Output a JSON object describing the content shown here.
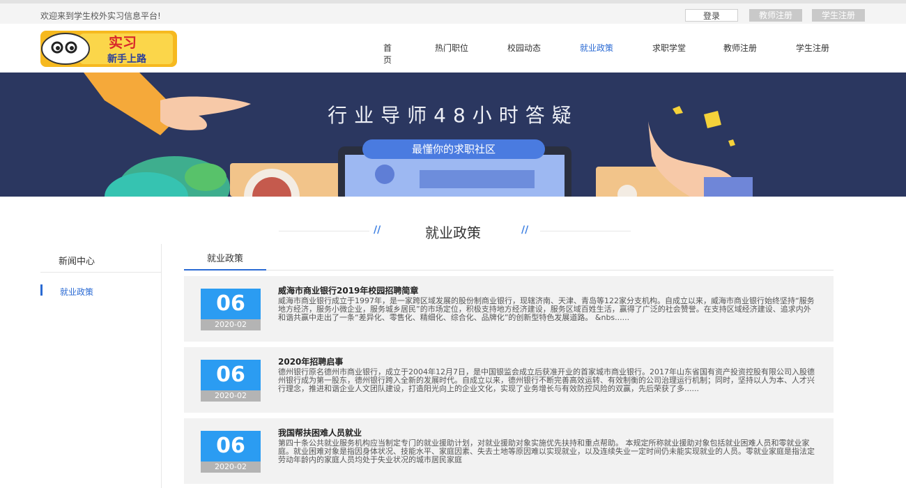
{
  "topbar": {
    "welcome": "欢迎来到学生校外实习信息平台!",
    "login": "登录",
    "teacher_register": "教师注册",
    "student_register": "学生注册"
  },
  "logo": {
    "text_top": "实习",
    "text_bottom": "新手上路"
  },
  "nav": {
    "items": [
      "首页",
      "热门职位",
      "校园动态",
      "就业政策",
      "求职学堂",
      "教师注册",
      "学生注册"
    ],
    "active": "就业政策"
  },
  "banner": {
    "title": "行业导师48小时答疑",
    "pill": "最懂你的求职社区"
  },
  "section": {
    "title": "就业政策"
  },
  "sidebar": {
    "header": "新闻中心",
    "item": "就业政策"
  },
  "tabs": {
    "active": "就业政策"
  },
  "articles": [
    {
      "day": "06",
      "month": "2020-02",
      "title": "威海市商业银行2019年校园招聘简章",
      "body": "威海市商业银行成立于1997年，是一家跨区域发展的股份制商业银行，现辖济南、天津、青岛等122家分支机构。自成立以来，威海市商业银行始终坚持“服务地方经济，服务小微企业，服务城乡居民”的市场定位，积极支持地方经济建设，服务区域百姓生活，赢得了广泛的社会赞誉。在支持区域经济建设、追求内外和谐共赢中走出了一条“差异化、零售化、精细化、综合化、品牌化”的创新型特色发展道路。 &nbs......"
    },
    {
      "day": "06",
      "month": "2020-02",
      "title": "2020年招聘启事",
      "body": "德州银行原名德州市商业银行，成立于2004年12月7日，是中国银监会成立后获准开业的首家城市商业银行。2017年山东省国有资产投资控股有限公司入股德州银行成为第一股东，德州银行跨入全新的发展时代。自成立以来，德州银行不断完善高效运转、有效制衡的公司治理运行机制；同时，坚持以人为本、人才兴行理念，推进和谐企业人文团队建设，打造阳光向上的企业文化，实现了业务增长与有效防控风险的双赢，先后荣获了多......"
    },
    {
      "day": "06",
      "month": "2020-02",
      "title": "我国帮扶困难人员就业",
      "body": "第四十条公共就业服务机构应当制定专门的就业援助计划，对就业援助对象实施优先扶持和重点帮助。 本规定所称就业援助对象包括就业困难人员和零就业家庭。就业困难对象是指因身体状况、技能水平、家庭因素、失去土地等原因难以实现就业，以及连续失业一定时间仍未能实现就业的人员。零就业家庭是指法定劳动年龄内的家庭人员均处于失业状况的城市居民家庭"
    }
  ],
  "colors": {
    "accent": "#2a6ad3",
    "date_blue": "#2b9cf2",
    "banner_bg": "#2b3760"
  }
}
